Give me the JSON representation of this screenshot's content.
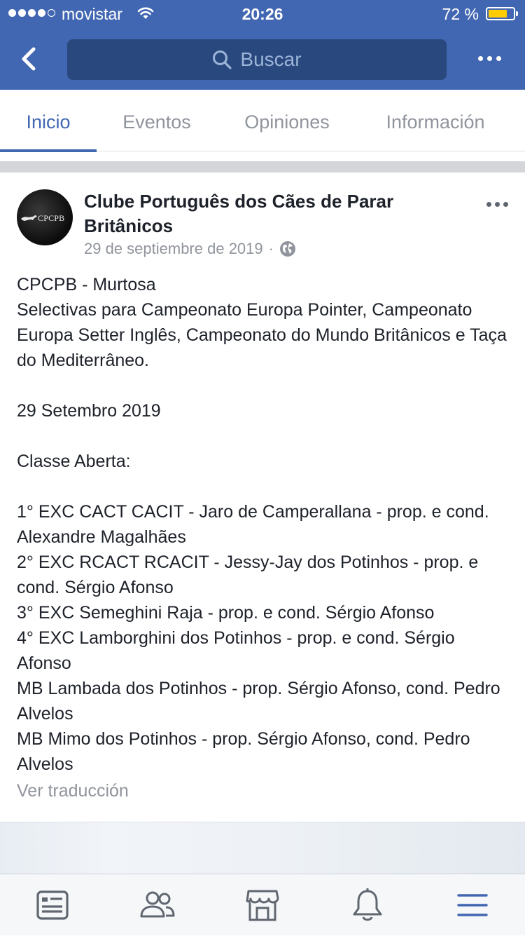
{
  "status_bar": {
    "carrier": "movistar",
    "time": "20:26",
    "battery": "72 %",
    "battery_level": 0.72,
    "signal_bars_filled": 4,
    "signal_bars_total": 5
  },
  "nav": {
    "search_placeholder": "Buscar",
    "icons": [
      "back-icon",
      "search-icon",
      "more-icon"
    ]
  },
  "tabs": [
    {
      "label": "Inicio",
      "active": true
    },
    {
      "label": "Eventos",
      "active": false
    },
    {
      "label": "Opiniones",
      "active": false
    },
    {
      "label": "Información",
      "active": false
    }
  ],
  "post": {
    "avatar_text": "CPCPB",
    "page_name": "Clube Português dos Cães de Parar Britânicos",
    "date": "29 de septiembre de 2019",
    "separator": "·",
    "privacy_icon": "globe-icon",
    "lines": [
      "CPCPB - Murtosa",
      "Selectivas para Campeonato Europa Pointer, Campeonato Europa Setter Inglês, Campeonato do Mundo Britânicos e Taça do Mediterrâneo.",
      "",
      "29 Setembro 2019",
      "",
      "Classe Aberta:",
      "",
      "1° EXC CACT CACIT - Jaro de Camperallana - prop. e cond. Alexandre Magalhães",
      "2° EXC RCACT RCACIT - Jessy-Jay dos Potinhos - prop. e cond. Sérgio Afonso",
      "3° EXC Semeghini Raja - prop. e cond. Sérgio Afonso",
      "4° EXC Lamborghini dos Potinhos - prop. e cond. Sérgio Afonso",
      "MB Lambada dos Potinhos - prop. Sérgio Afonso, cond. Pedro Alvelos",
      "MB Mimo dos Potinhos - prop. Sérgio Afonso, cond. Pedro Alvelos"
    ],
    "translate_link": "Ver traducción"
  },
  "bottom_bar": {
    "items": [
      "news-feed-icon",
      "groups-icon",
      "marketplace-icon",
      "notifications-icon",
      "menu-icon"
    ],
    "active_color": "#4267b2",
    "inactive_color": "#606770"
  },
  "colors": {
    "brand_blue": "#4267b2",
    "search_bg": "#29487d",
    "battery_fill": "#ffcc00",
    "secondary_text": "#90949c"
  }
}
